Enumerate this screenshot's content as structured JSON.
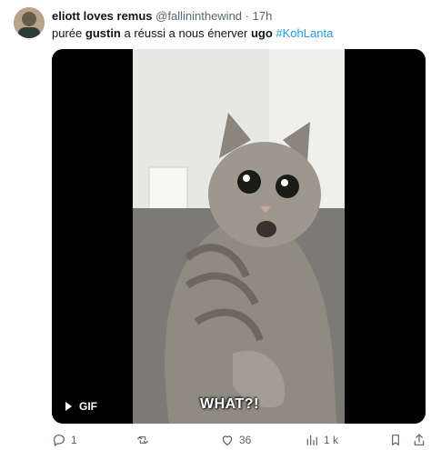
{
  "author": {
    "name": "eliott loves remus",
    "handle": "@fallininthewind",
    "separator": "·",
    "time": "17h"
  },
  "post": {
    "parts": [
      "purée ",
      "gustin",
      " a réussi a nous énerver ",
      "ugo",
      " ",
      "#KohLanta"
    ]
  },
  "media": {
    "type_label": "GIF",
    "caption": "WHAT?!"
  },
  "actions": {
    "replies": "1",
    "reposts": "",
    "likes": "36",
    "views": "1 k"
  },
  "colors": {
    "link": "#1d9bf0",
    "secondary_text": "#536471"
  }
}
